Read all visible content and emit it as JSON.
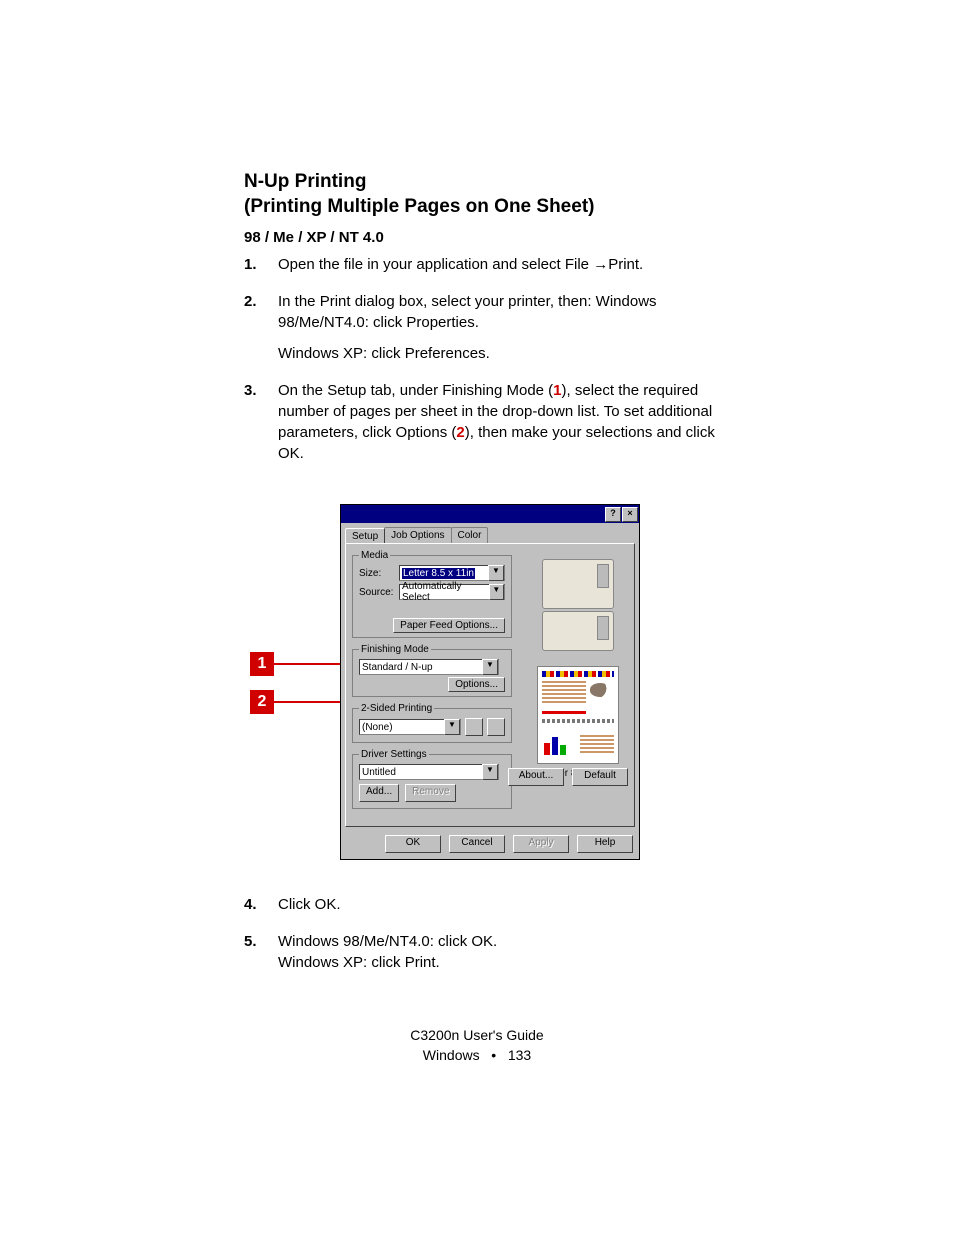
{
  "heading": "N-Up Printing\n (Printing Multiple Pages on One Sheet)",
  "subheading": "98 / Me / XP / NT 4.0",
  "steps": [
    {
      "n": "1.",
      "parts": [
        {
          "t": "Open the file in your application and select File "
        },
        {
          "t": "→",
          "arrow": true
        },
        {
          "t": "Print."
        }
      ]
    },
    {
      "n": "2.",
      "parts": [
        {
          "t": "In the Print dialog box, select your printer, then: Windows 98/Me/NT4.0: click Properties."
        },
        {
          "br": true
        },
        {
          "t": "Windows XP: click Preferences."
        }
      ]
    },
    {
      "n": "3.",
      "parts": [
        {
          "t": "On the Setup tab, under Finishing Mode ("
        },
        {
          "t": "1",
          "red": true
        },
        {
          "t": "), select the required number of pages per sheet in the drop-down list. To set additional parameters, click Options ("
        },
        {
          "t": "2",
          "red": true
        },
        {
          "t": "), then make your selections and click OK."
        }
      ]
    },
    {
      "n": "4.",
      "parts": [
        {
          "t": "Click OK."
        }
      ]
    },
    {
      "n": "5.",
      "parts": [
        {
          "t": "Windows 98/Me/NT4.0: click OK."
        },
        {
          "nl": true
        },
        {
          "t": "Windows XP: click Print."
        }
      ]
    }
  ],
  "callouts": {
    "c1": "1",
    "c2": "2"
  },
  "dialog": {
    "titlebar": {
      "help": "?",
      "close": "×"
    },
    "tabs": [
      "Setup",
      "Job Options",
      "Color"
    ],
    "active_tab_index": 0,
    "media": {
      "legend": "Media",
      "size_label": "Size:",
      "size_value": "Letter 8.5 x 11in",
      "source_label": "Source:",
      "source_value": "Automatically Select",
      "paper_feed_btn": "Paper Feed Options..."
    },
    "finishing": {
      "legend": "Finishing Mode",
      "value": "Standard / N-up",
      "options_btn": "Options..."
    },
    "duplex": {
      "legend": "2-Sided Printing",
      "value": "(None)"
    },
    "driver": {
      "legend": "Driver Settings",
      "value": "Untitled",
      "add_btn": "Add...",
      "remove_btn": "Remove"
    },
    "preview_label": "Letter 8.5 x 11in",
    "about_btn": "About...",
    "default_btn": "Default",
    "ok_btn": "OK",
    "cancel_btn": "Cancel",
    "apply_btn": "Apply",
    "help_btn": "Help"
  },
  "footer": {
    "line1": "C3200n User's Guide",
    "line2_a": "Windows",
    "bullet": "•",
    "page": "133"
  }
}
